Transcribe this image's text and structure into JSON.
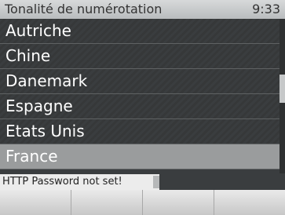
{
  "header": {
    "title": "Tonalité de numérotation",
    "time": "9:33"
  },
  "list": {
    "items": [
      {
        "label": "Autriche"
      },
      {
        "label": "Chine"
      },
      {
        "label": "Danemark"
      },
      {
        "label": "Espagne"
      },
      {
        "label": "Etats Unis"
      },
      {
        "label": "France",
        "selected": true
      }
    ]
  },
  "status": {
    "message": "HTTP Password not set!"
  },
  "softkeys": [
    {
      "label": ""
    },
    {
      "label": ""
    },
    {
      "label": ""
    },
    {
      "label": ""
    }
  ]
}
